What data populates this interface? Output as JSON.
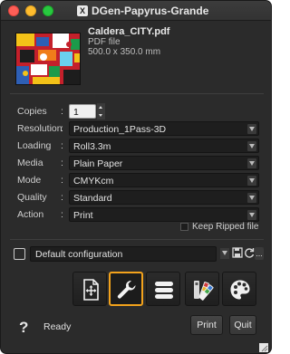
{
  "window": {
    "title": "DGen-Papyrus-Grande",
    "app_icon": "X"
  },
  "file": {
    "name": "Caldera_CITY.pdf",
    "type": "PDF file",
    "size": "500.0 x 350.0 mm"
  },
  "form": {
    "copies": {
      "label": "Copies",
      "value": "1"
    },
    "rows": [
      {
        "label": "Resolution",
        "value": "Production_1Pass-3D"
      },
      {
        "label": "Loading",
        "value": "Roll3.3m"
      },
      {
        "label": "Media",
        "value": "Plain Paper"
      },
      {
        "label": "Mode",
        "value": "CMYKcm"
      },
      {
        "label": "Quality",
        "value": "Standard"
      },
      {
        "label": "Action",
        "value": "Print"
      }
    ],
    "colon": ":"
  },
  "keep_ripped": {
    "label": "Keep Ripped file",
    "checked": false
  },
  "config": {
    "value": "Default configuration",
    "more": "..."
  },
  "toolbar": {
    "buttons": [
      {
        "icon": "document-move-icon",
        "active": false
      },
      {
        "icon": "wrench-icon",
        "active": true
      },
      {
        "icon": "stack-icon",
        "active": false
      },
      {
        "icon": "swatch-icon",
        "active": false
      },
      {
        "icon": "palette-icon",
        "active": false
      }
    ],
    "accent_color": "#f2a21c"
  },
  "footer": {
    "help": "?",
    "status": "Ready",
    "print": "Print",
    "quit": "Quit"
  }
}
